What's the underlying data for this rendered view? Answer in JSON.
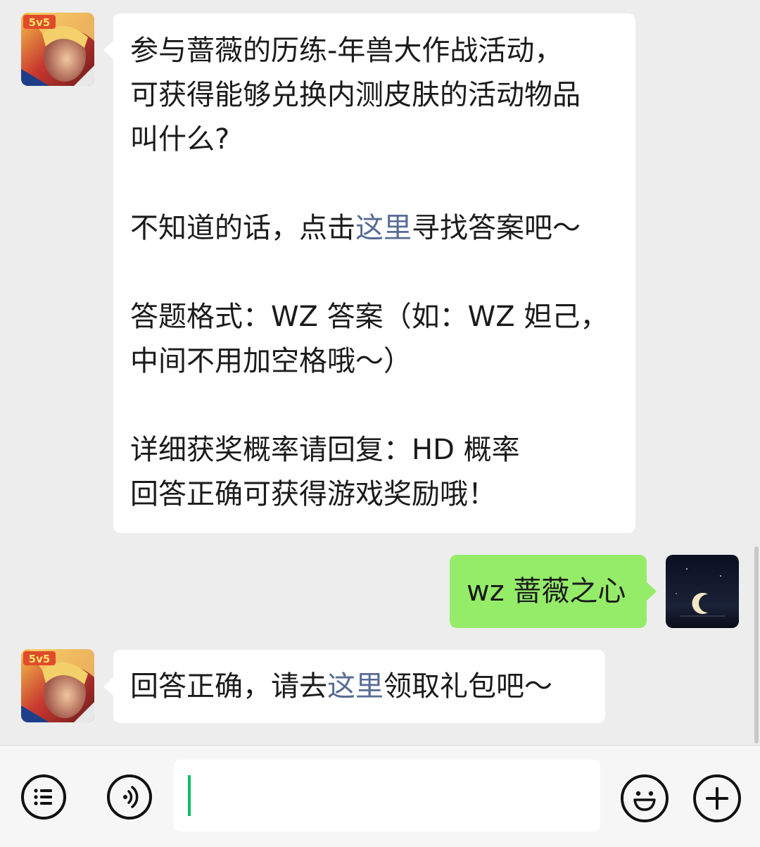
{
  "messages": [
    {
      "sender": "official-account",
      "avatar_badge": "5v5",
      "lines": [
        "参与蔷薇的历练-年兽大作战活动，",
        "可获得能够兑换内测皮肤的活动物品",
        "叫什么?",
        "",
        "不知道的话，点击",
        "这里",
        "寻找答案吧～",
        "",
        "答题格式：WZ 答案（如：WZ 妲己，",
        "中间不用加空格哦～）",
        "",
        "详细获奖概率请回复：HD 概率",
        "回答正确可获得游戏奖励哦！"
      ]
    },
    {
      "sender": "me",
      "text": "wz 蔷薇之心"
    },
    {
      "sender": "official-account",
      "avatar_badge": "5v5",
      "text_before": "回答正确，请去",
      "link": "这里",
      "text_after": "领取礼包吧～"
    }
  ],
  "input": {
    "value": ""
  },
  "icons": {
    "menu": "list-menu-icon",
    "voice": "voice-icon",
    "emoji": "emoji-icon",
    "more": "plus-icon"
  },
  "colors": {
    "background": "#ededed",
    "bubble_incoming": "#ffffff",
    "bubble_outgoing": "#95ec69",
    "link": "#576b95",
    "caret": "#07c160"
  }
}
